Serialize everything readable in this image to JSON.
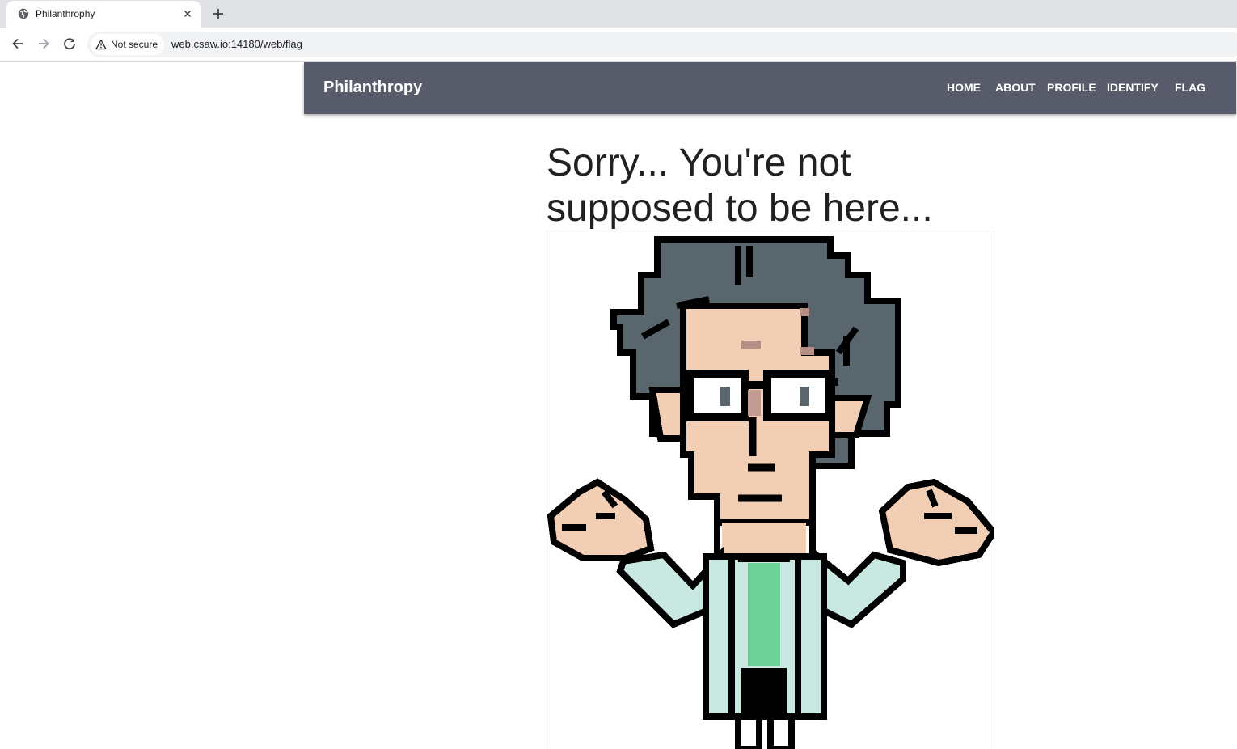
{
  "browser": {
    "tab_title": "Philanthrophy",
    "security_label": "Not secure",
    "url": "web.csaw.io:14180/web/flag"
  },
  "site": {
    "brand": "Philanthropy",
    "nav": [
      "HOME",
      "ABOUT",
      "PROFILE",
      "IDENTIFY",
      "FLAG"
    ]
  },
  "main": {
    "headline": "Sorry... You're not supposed to be here..."
  },
  "colors": {
    "navbar": "#585c6a",
    "hair": "#5a666e",
    "skin": "#f2ceb4",
    "coat": "#c9e8e2",
    "tie": "#6ed19a"
  },
  "icons": {
    "favicon": "globe-icon",
    "tab_close": "close-icon",
    "new_tab": "plus-icon",
    "back": "arrow-left-icon",
    "forward": "arrow-right-icon",
    "reload": "reload-icon",
    "security": "warning-triangle-icon"
  }
}
